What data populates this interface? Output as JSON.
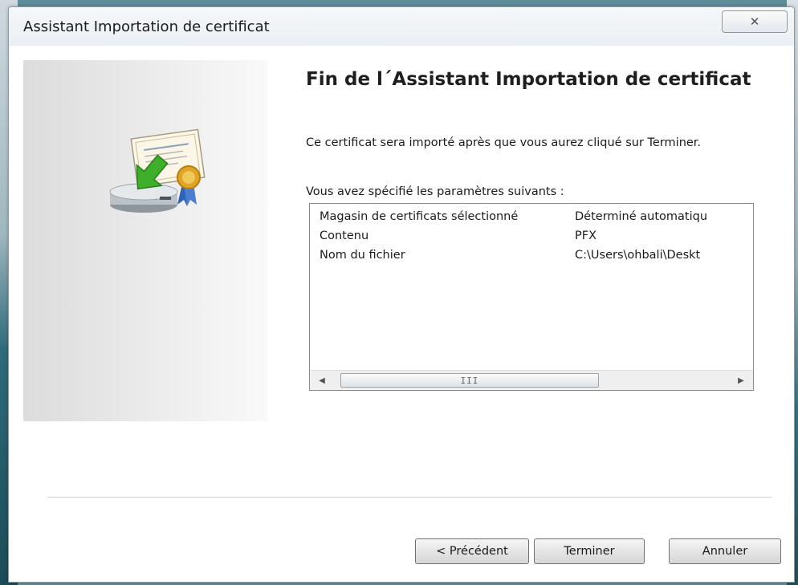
{
  "window": {
    "title": "Assistant Importation de certificat",
    "close_glyph": "✕"
  },
  "wizard": {
    "heading": "Fin de l´Assistant Importation de certificat",
    "description": "Ce certificat sera importé après que vous aurez cliqué sur Terminer.",
    "params_label": "Vous avez spécifié les paramètres suivants :",
    "settings": [
      {
        "name": "Magasin de certificats sélectionné",
        "value": "Déterminé automatiqu"
      },
      {
        "name": "Contenu",
        "value": "PFX"
      },
      {
        "name": "Nom du fichier",
        "value": "C:\\Users\\ohbali\\Deskt"
      }
    ],
    "scroll_grip": "III",
    "icon": "certificate-import-icon"
  },
  "buttons": {
    "previous": "< Précédent",
    "finish": "Terminer",
    "cancel": "Annuler"
  }
}
